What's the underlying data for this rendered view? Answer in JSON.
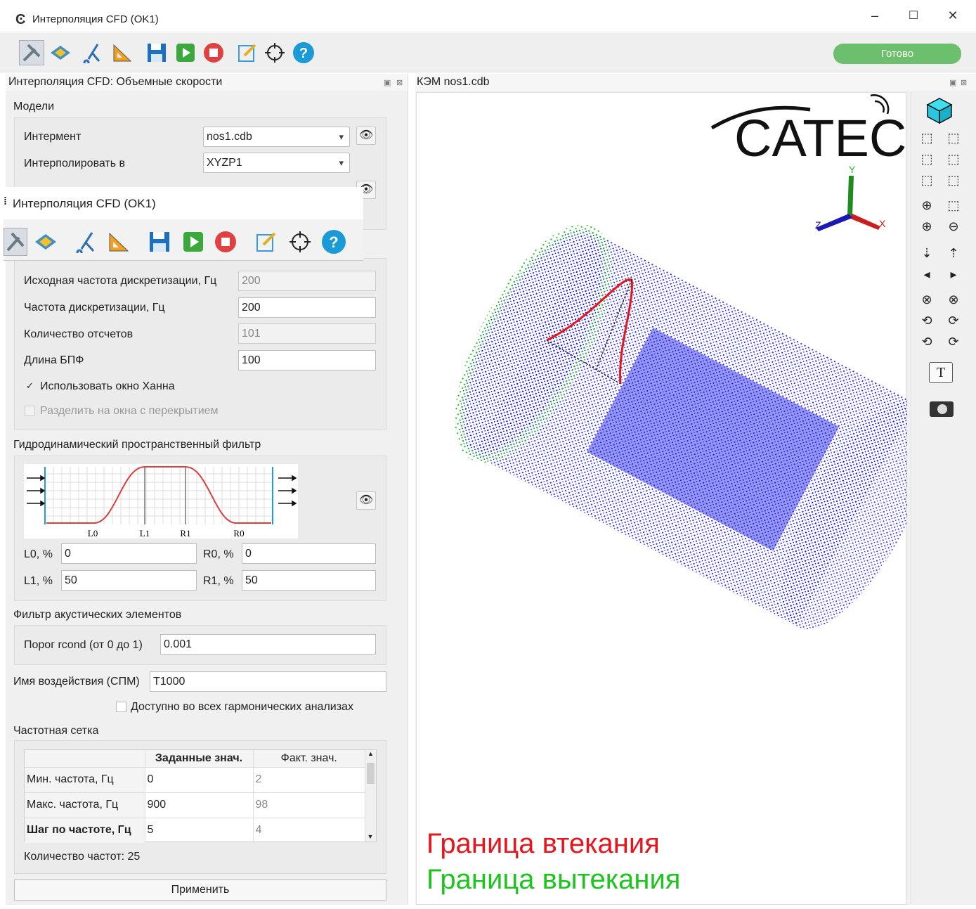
{
  "window": {
    "title": "Интерполяция CFD (OK1)",
    "minimize": "–",
    "maximize": "☐",
    "close": "✕"
  },
  "toolbar": {
    "icons": [
      "tools-icon",
      "mesh-icon",
      "cut-icon",
      "triangle-ruler-icon",
      "save-icon",
      "play-icon",
      "stop-icon",
      "edit-icon",
      "target-icon",
      "help-icon"
    ],
    "status": "Готово"
  },
  "left_panel": {
    "title": "Интерполяция CFD: Объемные скорости",
    "models": {
      "group_title": "Модели",
      "interment_label": "Интермент",
      "interment_value": "nos1.cdb",
      "interpolate_label": "Интерполировать в",
      "interpolate_value": "XYZP1"
    },
    "sampling": {
      "src_freq_label": "Исходная частота дискретизации, Гц",
      "src_freq_value": "200",
      "freq_label": "Частота дискретизации, Гц",
      "freq_value": "200",
      "count_label": "Количество отсчетов",
      "count_value": "101",
      "fft_label": "Длина БПФ",
      "fft_value": "100",
      "hann_label": "Использовать окно Ханна",
      "hann_checked": "✓",
      "overlap_label": "Разделить на окна с перекрытием"
    },
    "hydro_filter": {
      "group_title": "Гидродинамический пространственный фильтр",
      "axis_labels": [
        "L0",
        "L1",
        "R1",
        "R0"
      ],
      "l0_label": "L0, %",
      "l0_value": "0",
      "r0_label": "R0, %",
      "r0_value": "0",
      "l1_label": "L1, %",
      "l1_value": "50",
      "r1_label": "R1, %",
      "r1_value": "50"
    },
    "acoustic_filter": {
      "group_title": "Фильтр акустических элементов",
      "rcond_label": "Порог rcond (от 0 до 1)",
      "rcond_value": "0.001"
    },
    "action": {
      "name_label": "Имя воздействия (СПМ)",
      "name_value": "T1000",
      "all_harmonic_label": "Доступно во всех гармонических анализах"
    },
    "freq_grid": {
      "group_title": "Частотная сетка",
      "headers": [
        "",
        "Заданные знач.",
        "Факт. знач."
      ],
      "rows": [
        {
          "label": "Мин. частота, Гц",
          "set": "0",
          "actual": "2"
        },
        {
          "label": "Макс. частота, Гц",
          "set": "900",
          "actual": "98"
        },
        {
          "label": "Шаг по частоте, Гц",
          "set": "5",
          "actual": "4"
        }
      ],
      "count_text": "Количество частот: 25"
    },
    "apply_button": "Применить"
  },
  "overlay": {
    "title": "Интерполяция CFD (OK1)"
  },
  "viewport": {
    "title": "КЭМ nos1.cdb",
    "logo": "CATEC",
    "axes": {
      "y": "Y",
      "z": "Z",
      "x": "X"
    },
    "legend_inflow": "Граница втекания",
    "legend_outflow": "Граница вытекания",
    "inflow_color": "#e8141c",
    "outflow_color": "#1ec41e",
    "mesh_color": "#1a1ae6"
  },
  "view_toolbar": {
    "icons": [
      "iso-cube-icon",
      "front-view-icon",
      "back-view-icon",
      "left-view-icon",
      "right-view-icon",
      "top-view-icon",
      "bottom-view-icon",
      "zoom-fit-icon",
      "zoom-box-icon",
      "zoom-in-icon",
      "zoom-out-icon",
      "pan-down-icon",
      "pan-up-icon",
      "pan-left-icon",
      "pan-right-icon",
      "rotate-x-neg-icon",
      "rotate-x-pos-icon",
      "rotate-y-neg-icon",
      "rotate-y-pos-icon",
      "rotate-z-neg-icon",
      "rotate-z-pos-icon",
      "text-icon",
      "screenshot-icon"
    ]
  }
}
